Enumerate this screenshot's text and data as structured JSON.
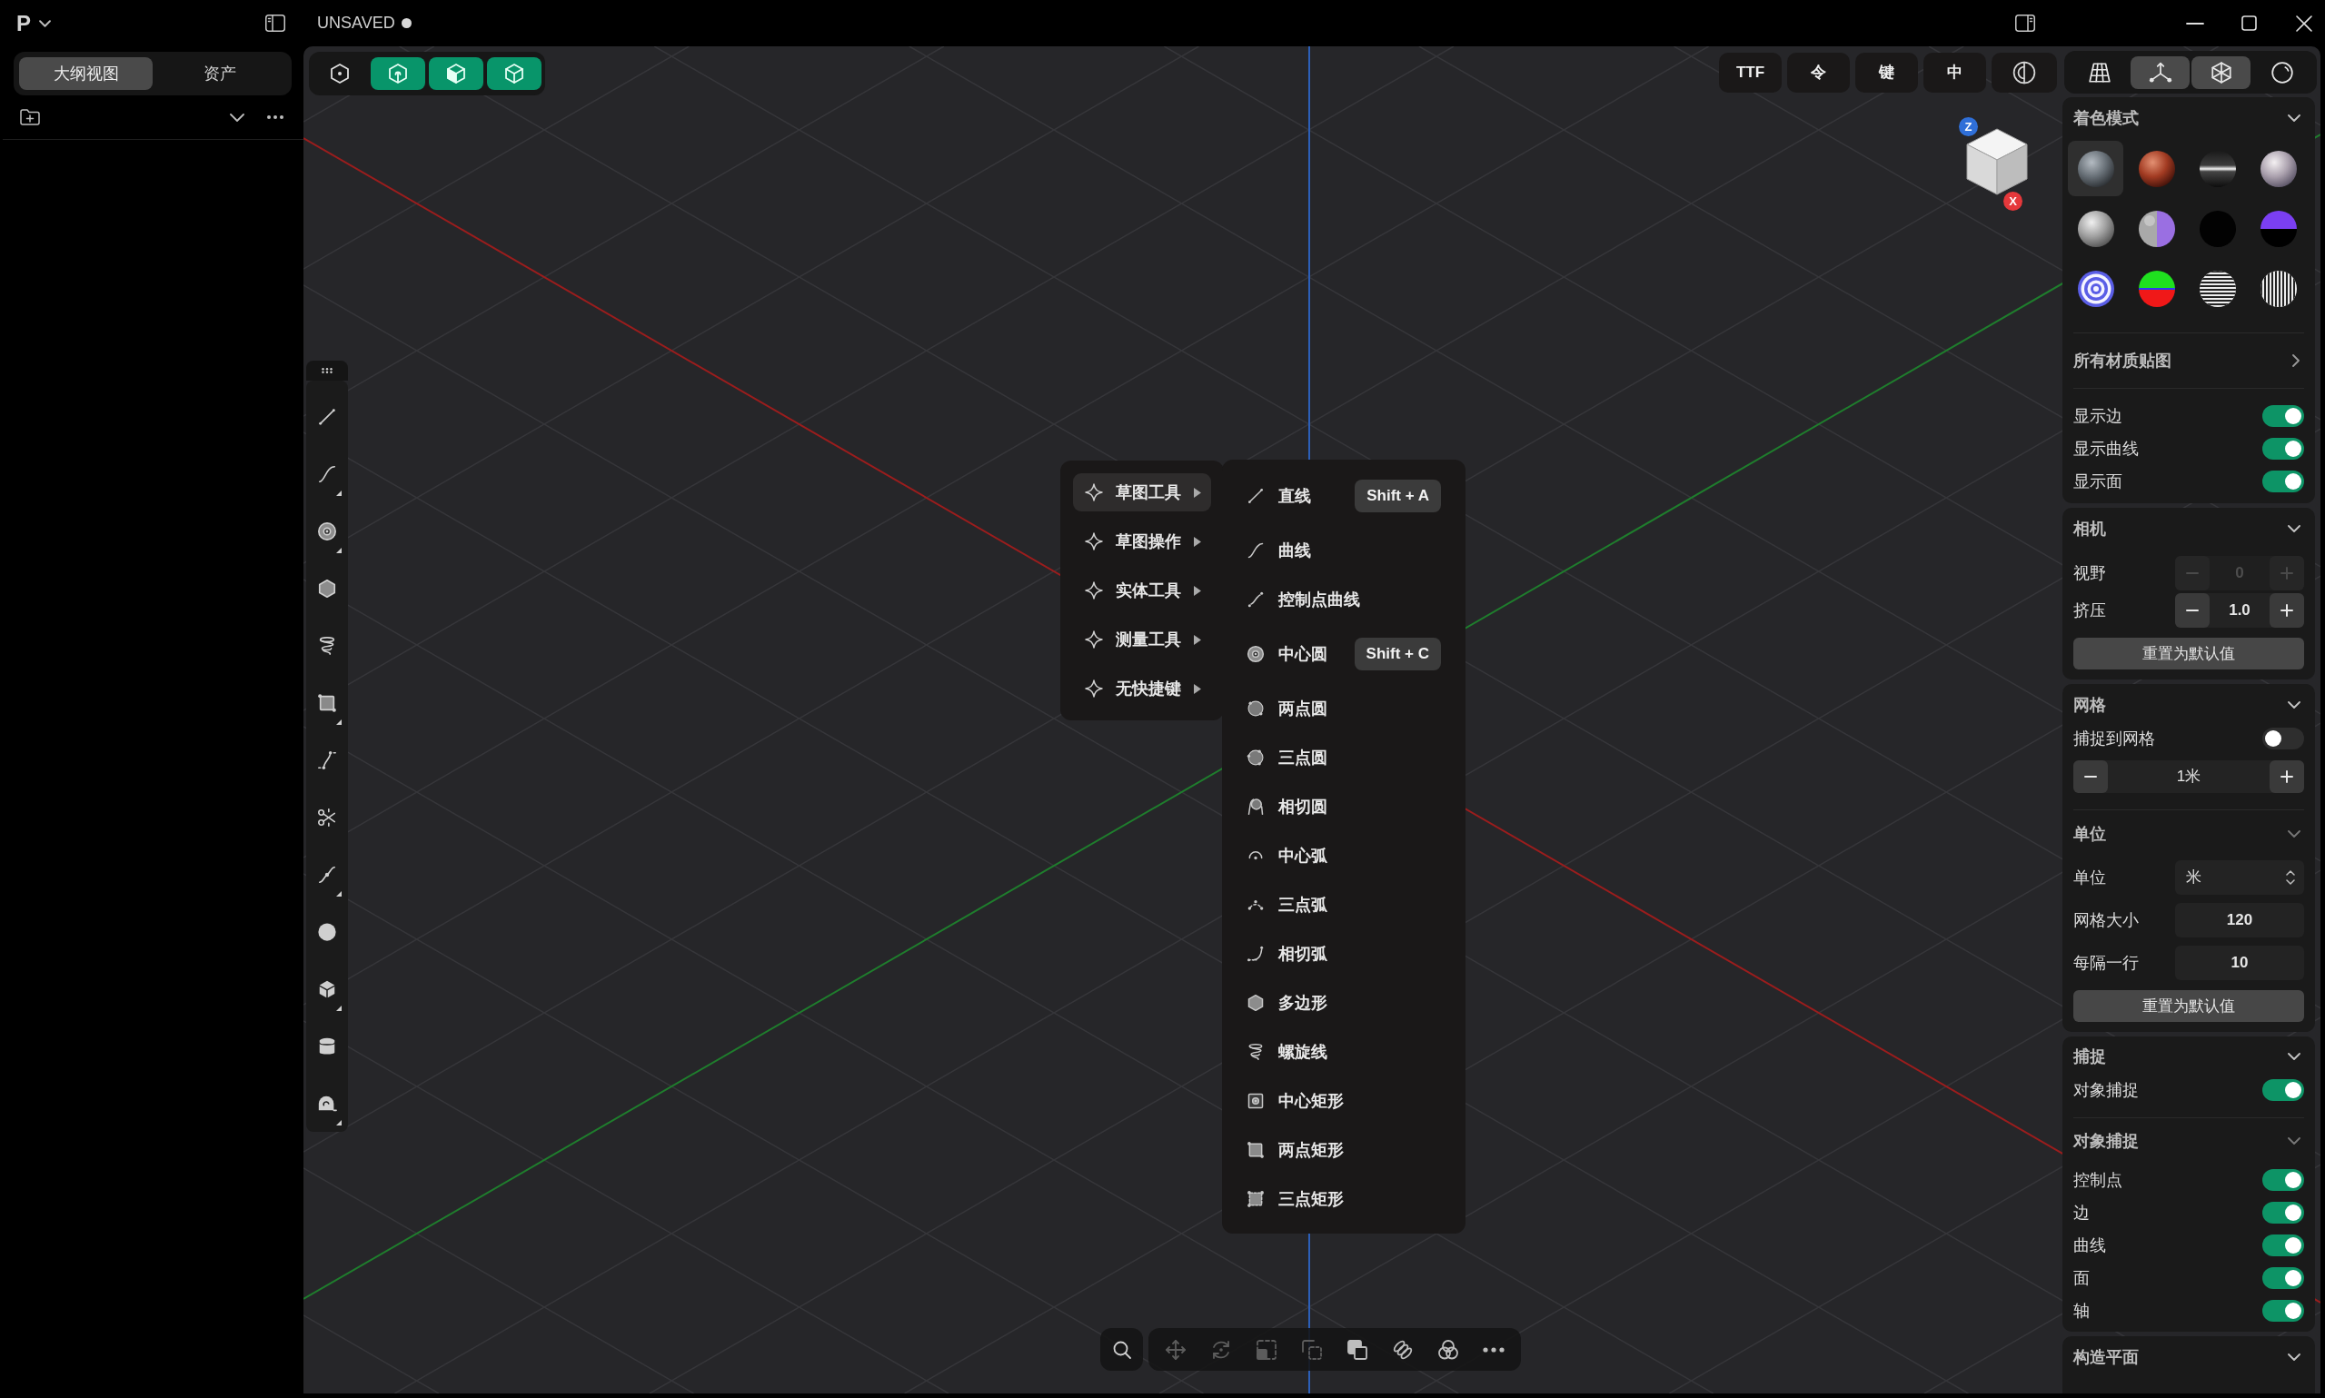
{
  "title_bar": {
    "logo": "P",
    "document_status": "UNSAVED",
    "modified": true
  },
  "sidebar": {
    "tabs": [
      {
        "label": "大纲视图",
        "selected": true
      },
      {
        "label": "资产",
        "selected": false
      }
    ]
  },
  "viewport": {
    "mode_buttons": [
      {
        "kind": "sketch",
        "on": false
      },
      {
        "kind": "part",
        "on": true
      },
      {
        "kind": "solid",
        "on": true
      },
      {
        "kind": "outline",
        "on": true
      }
    ],
    "text_buttons": [
      "TTF",
      "令",
      "键",
      "中"
    ],
    "view_buttons": [
      {
        "kind": "grid",
        "selected": false
      },
      {
        "kind": "axes",
        "selected": true
      },
      {
        "kind": "wireframe",
        "selected": true
      },
      {
        "kind": "ball",
        "selected": false
      }
    ],
    "view_cube": {
      "axes": [
        {
          "label": "Z",
          "color": "#2f6fd8"
        },
        {
          "label": "X",
          "color": "#e5383b"
        }
      ]
    },
    "tool_strip": [
      {
        "kind": "line",
        "expandable": false
      },
      {
        "kind": "curve",
        "expandable": true
      },
      {
        "kind": "centercircle",
        "expandable": true
      },
      {
        "kind": "polygon",
        "expandable": false
      },
      {
        "kind": "helix",
        "expandable": false
      },
      {
        "kind": "twopointrect",
        "expandable": true
      },
      {
        "kind": "spline",
        "expandable": false
      },
      {
        "kind": "split",
        "expandable": false
      },
      {
        "kind": "curvepoint",
        "expandable": true
      },
      {
        "kind": "sphere",
        "expandable": false
      },
      {
        "kind": "cube",
        "expandable": true
      },
      {
        "kind": "cylinder",
        "expandable": false
      },
      {
        "kind": "tape",
        "expandable": true
      }
    ],
    "context_menu": {
      "items": [
        {
          "label": "草图工具",
          "selected": true
        },
        {
          "label": "草图操作",
          "selected": false
        },
        {
          "label": "实体工具",
          "selected": false
        },
        {
          "label": "测量工具",
          "selected": false
        },
        {
          "label": "无快捷键",
          "selected": false
        }
      ],
      "submenu": [
        {
          "kind": "line",
          "label": "直线",
          "shortcut": "Shift + A"
        },
        {
          "kind": "curve",
          "label": "曲线"
        },
        {
          "kind": "cpcurve",
          "label": "控制点曲线"
        },
        {
          "kind": "centercircle",
          "label": "中心圆",
          "shortcut": "Shift + C"
        },
        {
          "kind": "twopointcircle",
          "label": "两点圆"
        },
        {
          "kind": "threepointcircle",
          "label": "三点圆"
        },
        {
          "kind": "tangentcircle",
          "label": "相切圆"
        },
        {
          "kind": "centerarc",
          "label": "中心弧"
        },
        {
          "kind": "threepointarc",
          "label": "三点弧"
        },
        {
          "kind": "tangentarc",
          "label": "相切弧"
        },
        {
          "kind": "polygon",
          "label": "多边形"
        },
        {
          "kind": "helix",
          "label": "螺旋线"
        },
        {
          "kind": "centerrect",
          "label": "中心矩形"
        },
        {
          "kind": "twopointrect",
          "label": "两点矩形"
        },
        {
          "kind": "threepointrect",
          "label": "三点矩形"
        }
      ]
    },
    "bottom_toolbar": [
      {
        "kind": "move",
        "disabled": true
      },
      {
        "kind": "rotate",
        "disabled": true
      },
      {
        "kind": "scale",
        "disabled": true
      },
      {
        "kind": "duplicate",
        "disabled": true
      },
      {
        "kind": "overlap",
        "disabled": false
      },
      {
        "kind": "link",
        "disabled": false
      },
      {
        "kind": "venn",
        "disabled": false
      },
      {
        "kind": "more",
        "disabled": false
      }
    ]
  },
  "properties_panel": {
    "shading": {
      "title": "着色模式",
      "materials": [
        {
          "kind": "steel",
          "selected": true
        },
        {
          "kind": "copper",
          "selected": false
        },
        {
          "kind": "chrome",
          "selected": false
        },
        {
          "kind": "pearl",
          "selected": false
        },
        {
          "kind": "silver",
          "selected": false
        },
        {
          "kind": "split",
          "selected": false
        },
        {
          "kind": "black",
          "selected": false
        },
        {
          "kind": "horizon",
          "selected": false
        },
        {
          "kind": "rings",
          "selected": false
        },
        {
          "kind": "rgb",
          "selected": false
        },
        {
          "kind": "hstripes",
          "selected": false
        },
        {
          "kind": "vstripes",
          "selected": false
        }
      ],
      "textures_link": "所有材质贴图",
      "toggles": [
        {
          "label": "显示边",
          "on": true
        },
        {
          "label": "显示曲线",
          "on": true
        },
        {
          "label": "显示面",
          "on": true
        }
      ]
    },
    "camera": {
      "title": "相机",
      "steppers": [
        {
          "label": "视野",
          "value": "0",
          "disabled": true
        },
        {
          "label": "挤压",
          "value": "1.0",
          "disabled": false
        }
      ],
      "reset_button": "重置为默认值"
    },
    "grid": {
      "title": "网格",
      "snap_toggle": {
        "label": "捕捉到网格",
        "on": false
      },
      "spacing": "1米"
    },
    "units": {
      "title": "单位",
      "unit_select": {
        "label": "单位",
        "value": "米"
      },
      "fields": [
        {
          "label": "网格大小",
          "value": "120"
        },
        {
          "label": "每隔一行",
          "value": "10"
        }
      ],
      "reset_button": "重置为默认值"
    },
    "snapping": {
      "title": "捕捉",
      "object_snap": {
        "label": "对象捕捉",
        "on": true
      }
    },
    "object_snap": {
      "title": "对象捕捉",
      "toggles": [
        {
          "label": "控制点",
          "on": true
        },
        {
          "label": "边",
          "on": true
        },
        {
          "label": "曲线",
          "on": true
        },
        {
          "label": "面",
          "on": true
        },
        {
          "label": "轴",
          "on": true
        }
      ]
    },
    "construction_plane": {
      "title": "构造平面"
    }
  }
}
